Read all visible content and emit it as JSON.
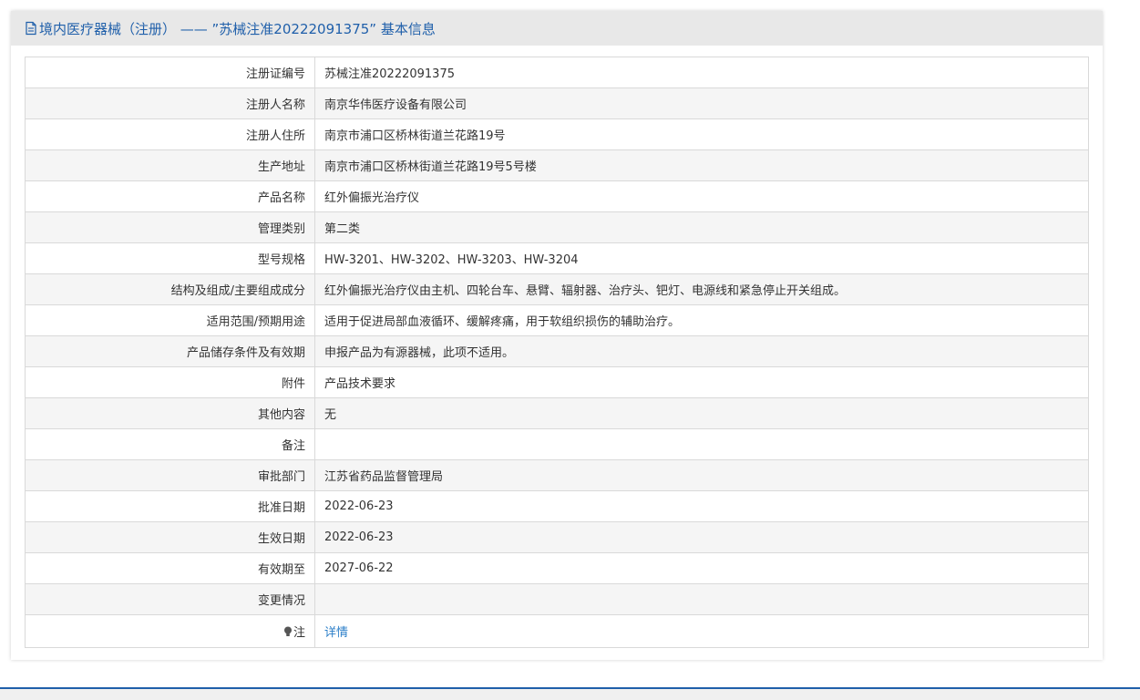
{
  "header": {
    "icon": "document-icon",
    "title": "境内医疗器械（注册） ——  ”苏械注准20222091375” 基本信息"
  },
  "rows": [
    {
      "label": "注册证编号",
      "value": "苏械注准20222091375"
    },
    {
      "label": "注册人名称",
      "value": "南京华伟医疗设备有限公司"
    },
    {
      "label": "注册人住所",
      "value": "南京市浦口区桥林街道兰花路19号"
    },
    {
      "label": "生产地址",
      "value": "南京市浦口区桥林街道兰花路19号5号楼"
    },
    {
      "label": "产品名称",
      "value": "红外偏振光治疗仪"
    },
    {
      "label": "管理类别",
      "value": "第二类"
    },
    {
      "label": "型号规格",
      "value": "HW-3201、HW-3202、HW-3203、HW-3204"
    },
    {
      "label": "结构及组成/主要组成成分",
      "value": "红外偏振光治疗仪由主机、四轮台车、悬臂、辐射器、治疗头、钯灯、电源线和紧急停止开关组成。"
    },
    {
      "label": "适用范围/预期用途",
      "value": "适用于促进局部血液循环、缓解疼痛，用于软组织损伤的辅助治疗。"
    },
    {
      "label": "产品储存条件及有效期",
      "value": "申报产品为有源器械，此项不适用。"
    },
    {
      "label": "附件",
      "value": "产品技术要求"
    },
    {
      "label": "其他内容",
      "value": "无"
    },
    {
      "label": "备注",
      "value": ""
    },
    {
      "label": "审批部门",
      "value": "江苏省药品监督管理局"
    },
    {
      "label": "批准日期",
      "value": "2022-06-23"
    },
    {
      "label": "生效日期",
      "value": "2022-06-23"
    },
    {
      "label": "有效期至",
      "value": "2027-06-22"
    },
    {
      "label": "变更情况",
      "value": ""
    }
  ],
  "note": {
    "icon": "lightbulb-icon",
    "label": "注",
    "link": "详情"
  },
  "colors": {
    "accent": "#1f5faa",
    "link": "#2a7ec8",
    "header_bg": "#e8e8e8",
    "row_alt_bg": "#f5f5f5",
    "border": "#d9d9d9",
    "text": "#333333"
  }
}
